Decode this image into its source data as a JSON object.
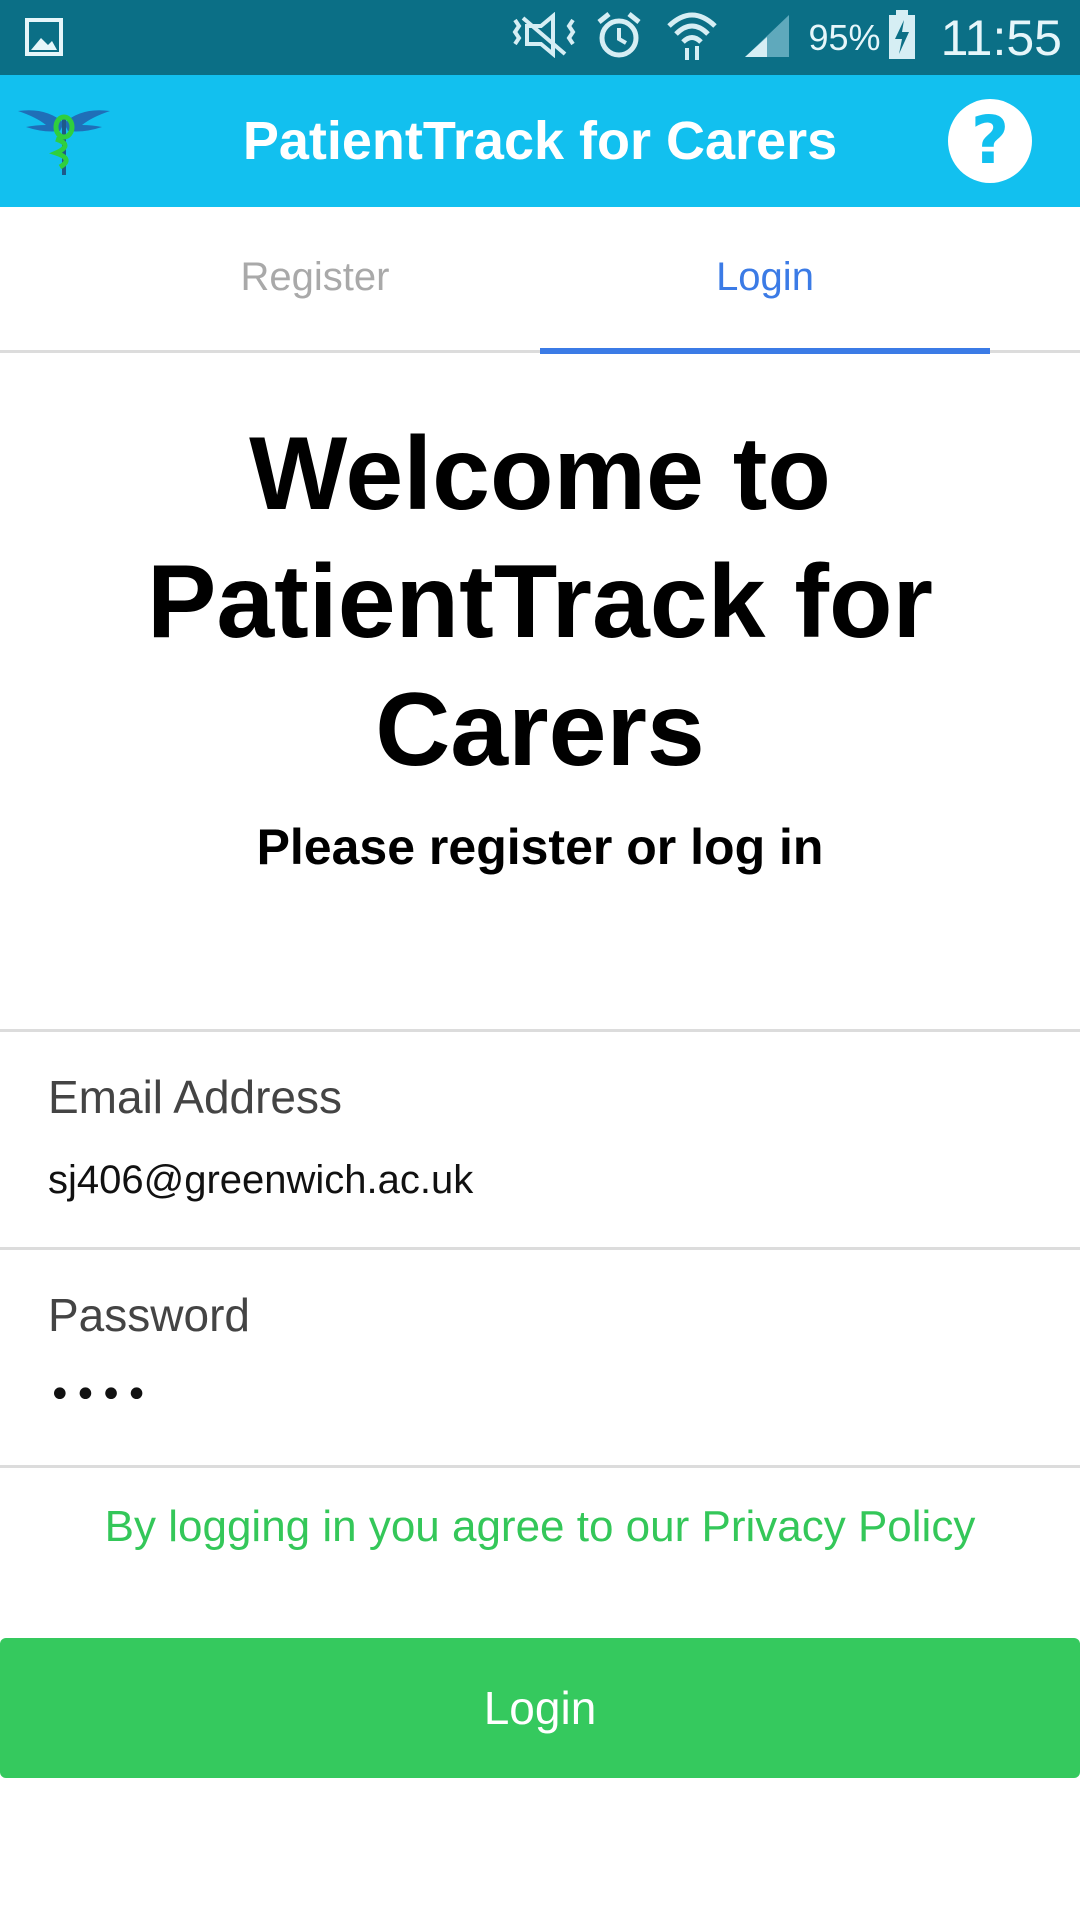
{
  "status_bar": {
    "battery_percent": "95%",
    "time": "11:55",
    "icons": [
      "gallery-icon",
      "vibrate-off-icon",
      "alarm-icon",
      "wifi-icon",
      "signal-icon",
      "battery-charging-icon"
    ]
  },
  "app_bar": {
    "title": "PatientTrack for Carers",
    "logo": "caduceus-logo",
    "help_label": "?"
  },
  "tabs": {
    "register": "Register",
    "login": "Login",
    "active": "login"
  },
  "welcome": {
    "title": "Welcome to PatientTrack for Carers",
    "subtitle": "Please register or log in"
  },
  "form": {
    "email": {
      "label": "Email Address",
      "value": "sj406@greenwich.ac.uk"
    },
    "password": {
      "label": "Password",
      "value": "••••"
    }
  },
  "privacy_text": "By logging in you agree to our Privacy Policy",
  "login_button": "Login",
  "colors": {
    "status_bar": "#0b6f86",
    "app_bar": "#12c0ef",
    "tab_active": "#3b7be6",
    "tab_inactive": "#a9a9a9",
    "accent_green": "#35c95e"
  }
}
